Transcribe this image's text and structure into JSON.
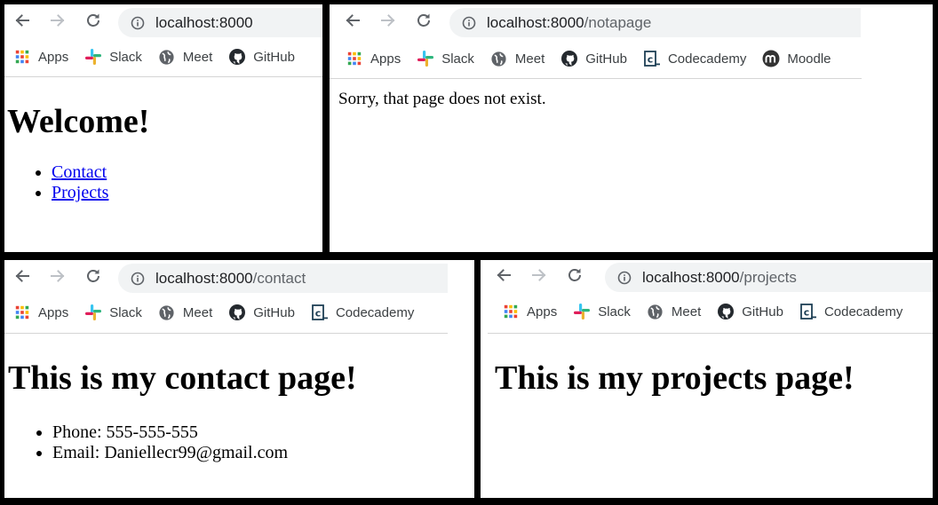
{
  "nav": {
    "back_icon": "back-arrow-icon",
    "forward_icon": "forward-arrow-icon",
    "reload_icon": "reload-icon",
    "info_icon": "info-circle-icon"
  },
  "bookmarks": [
    {
      "label": "Apps",
      "icon": "apps-grid-icon"
    },
    {
      "label": "Slack",
      "icon": "slack-icon"
    },
    {
      "label": "Meet",
      "icon": "globe-icon"
    },
    {
      "label": "GitHub",
      "icon": "github-icon"
    },
    {
      "label": "Codecademy",
      "icon": "codecademy-icon"
    },
    {
      "label": "Moodle",
      "icon": "moodle-icon"
    }
  ],
  "windows": {
    "home": {
      "url_host": "localhost:8000",
      "url_path": "",
      "heading": "Welcome!",
      "links": [
        "Contact",
        "Projects"
      ]
    },
    "notapage": {
      "url_host": "localhost:8000",
      "url_path": "/notapage",
      "message": "Sorry, that page does not exist."
    },
    "contact": {
      "url_host": "localhost:8000",
      "url_path": "/contact",
      "heading": "This is my contact page!",
      "items": [
        "Phone: 555-555-555",
        "Email: Daniellecr99@gmail.com"
      ]
    },
    "projects": {
      "url_host": "localhost:8000",
      "url_path": "/projects",
      "heading": "This is my projects page!"
    }
  },
  "colors": {
    "link": "#0000ee",
    "omnibox_bg": "#f1f3f4",
    "divider": "#d5d5d5",
    "border": "#000000"
  }
}
